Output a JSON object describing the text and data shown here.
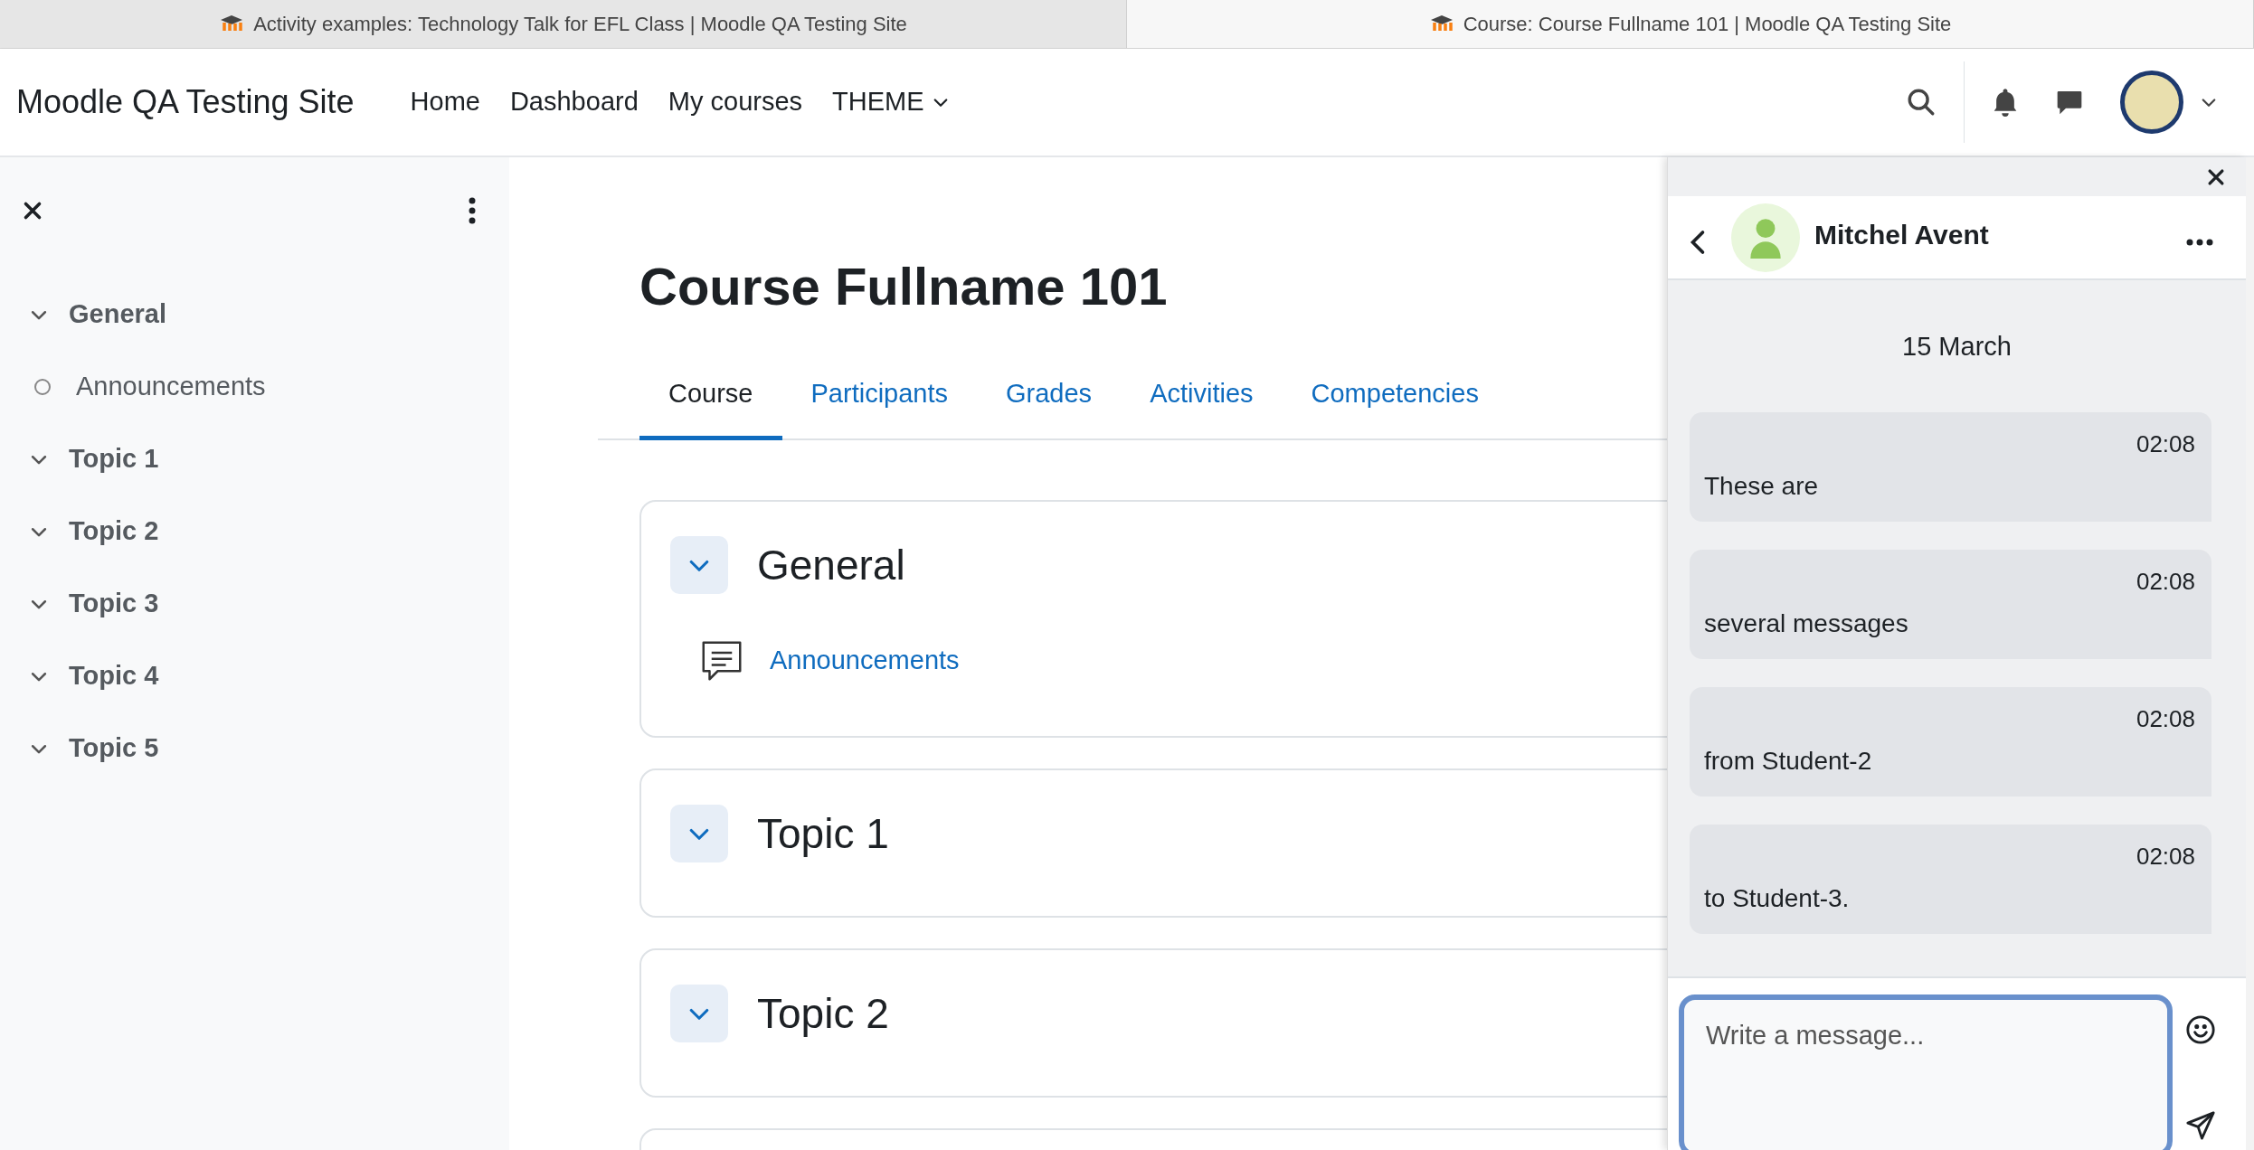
{
  "browser_tabs": [
    {
      "title": "Activity examples: Technology Talk for EFL Class | Moodle QA Testing Site",
      "selected": false
    },
    {
      "title": "Course: Course Fullname 101 | Moodle QA Testing Site",
      "selected": true
    }
  ],
  "navbar": {
    "site_name": "Moodle QA Testing Site",
    "links": [
      {
        "label": "Home",
        "kind": "link"
      },
      {
        "label": "Dashboard",
        "kind": "link"
      },
      {
        "label": "My courses",
        "kind": "link"
      },
      {
        "label": "THEME",
        "kind": "dropdown"
      }
    ]
  },
  "course_index": [
    {
      "label": "General",
      "expanded": true,
      "children": [
        {
          "label": "Announcements"
        }
      ]
    },
    {
      "label": "Topic 1",
      "expanded": true
    },
    {
      "label": "Topic 2",
      "expanded": true
    },
    {
      "label": "Topic 3",
      "expanded": true
    },
    {
      "label": "Topic 4",
      "expanded": true
    },
    {
      "label": "Topic 5",
      "expanded": true
    }
  ],
  "course": {
    "title": "Course Fullname 101",
    "tabs": [
      {
        "label": "Course",
        "selected": true
      },
      {
        "label": "Participants",
        "selected": false
      },
      {
        "label": "Grades",
        "selected": false
      },
      {
        "label": "Activities",
        "selected": false
      },
      {
        "label": "Competencies",
        "selected": false
      }
    ],
    "sections": [
      {
        "title": "General",
        "expanded": true,
        "activities": [
          {
            "name": "Announcements"
          }
        ]
      },
      {
        "title": "Topic 1",
        "expanded": true
      },
      {
        "title": "Topic 2",
        "expanded": true
      }
    ]
  },
  "messaging": {
    "contact_name": "Mitchel Avent",
    "date": "15 March",
    "messages": [
      {
        "time": "02:08",
        "text": "These are"
      },
      {
        "time": "02:08",
        "text": "several messages"
      },
      {
        "time": "02:08",
        "text": "from Student-2"
      },
      {
        "time": "02:08",
        "text": "to Student-3."
      }
    ],
    "composer": {
      "placeholder": "Write a message..."
    }
  }
}
